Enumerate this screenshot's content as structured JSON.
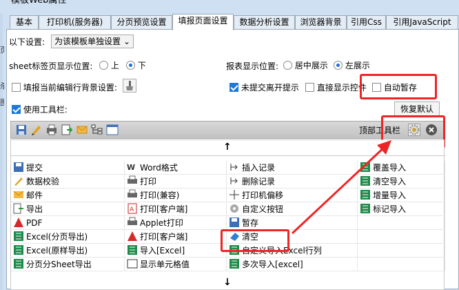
{
  "window": {
    "title": "模板Web属性"
  },
  "left_edge_glyphs": [
    "页",
    "杀",
    "图"
  ],
  "tabs": [
    {
      "label": "基本"
    },
    {
      "label": "打印机(服务器)"
    },
    {
      "label": "分页预览设置"
    },
    {
      "label": "填报页面设置",
      "active": true
    },
    {
      "label": "数据分析设置"
    },
    {
      "label": "浏览器背景"
    },
    {
      "label": "引用Css"
    },
    {
      "label": "引用JavaScript"
    }
  ],
  "settings": {
    "scope_label": "以下设置:",
    "scope_value": "为该模板单独设置",
    "sheet_tab_label": "sheet标签页显示位置:",
    "sheet_top": "上",
    "sheet_bottom": "下",
    "report_pos_label": "报表显示位置:",
    "report_center": "居中展示",
    "report_left": "左展示",
    "fill_bg_label": "填报当前编辑行背景设置:",
    "unsubmitted_label": "未提交离开提示",
    "direct_show_label": "直接显示控件",
    "autosave_label": "自动暂存",
    "use_toolbar_label": "使用工具栏:",
    "restore_default": "恢复默认",
    "toolbar_position_label": "顶部工具栏"
  },
  "toolbar_icons": [
    "save-icon",
    "edit-icon",
    "print-icon",
    "export-icon",
    "email-icon",
    "tree-icon",
    "window-icon"
  ],
  "tool_items": {
    "col1": [
      "提交",
      "数据校验",
      "邮件",
      "导出",
      "PDF",
      "Excel(分页导出)",
      "Excel(原样导出)",
      "分页分Sheet导出"
    ],
    "col2": [
      "Word格式",
      "打印",
      "打印(兼容)",
      "打印[客户端]",
      "Applet打印",
      "打印[客户端]",
      "导入[Excel]",
      "显示单元格值"
    ],
    "col3": [
      "插入记录",
      "删除记录",
      "打印机偏移",
      "自定义按钮",
      "暂存",
      "清空",
      "自定义导入Excel行列",
      "多次导入[excel]"
    ],
    "col4": [
      "覆盖导入",
      "清空导入",
      "增量导入",
      "标记导入"
    ]
  },
  "colors": {
    "highlight": "#ee2424",
    "accent": "#1e78d7",
    "window_bg": "#cfe0f3"
  }
}
